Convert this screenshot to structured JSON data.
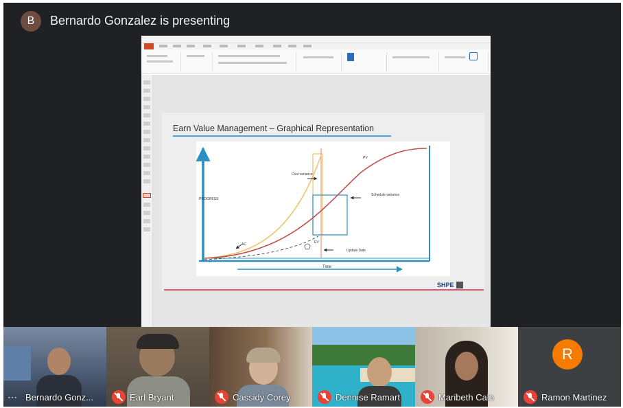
{
  "presenter": {
    "avatar_initial": "B",
    "text": "Bernardo Gonzalez is presenting"
  },
  "slide": {
    "title": "Earn Value Management – Graphical Representation",
    "labels": {
      "progress": "PROGRESS",
      "time": "Time",
      "pv": "PV",
      "ac": "AC",
      "ev": "EV",
      "cost_variance": "Cost variance",
      "schedule_variance": "Schedule variance",
      "update_date": "Update Date"
    },
    "logo_text": "SHPE"
  },
  "participants": [
    {
      "name": "Bernardo Gonz...",
      "muted": false,
      "icon": "more-options-icon"
    },
    {
      "name": "Earl Bryant",
      "muted": true,
      "icon": "mic-off-icon"
    },
    {
      "name": "Cassidy Corey",
      "muted": true,
      "icon": "mic-off-icon"
    },
    {
      "name": "Dennise Ramart",
      "muted": true,
      "icon": "mic-off-icon"
    },
    {
      "name": "Maribeth Calo",
      "muted": true,
      "icon": "mic-off-icon"
    },
    {
      "name": "Ramon Martinez",
      "muted": true,
      "icon": "mic-off-icon",
      "avatar_initial": "R"
    }
  ],
  "colors": {
    "background": "#202124",
    "presenter_avatar": "#6d4c41",
    "mute_red": "#ea4335",
    "ramon_avatar": "#f57c00",
    "chart_axis": "#2a8fc1",
    "curve_pv": "#c0504d",
    "curve_ev": "#f0c26b",
    "slide_rule": "#e4526e"
  }
}
